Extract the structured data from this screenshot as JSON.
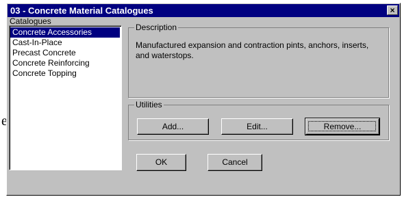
{
  "background": {
    "text_fragment": "e"
  },
  "window": {
    "title": "03 - Concrete Material Catalogues",
    "close_glyph": "×"
  },
  "catalogues": {
    "label": "Catalogues",
    "items": [
      {
        "label": "Concrete Accessories",
        "selected": true
      },
      {
        "label": "Cast-In-Place",
        "selected": false
      },
      {
        "label": "Precast Concrete",
        "selected": false
      },
      {
        "label": "Concrete Reinforcing",
        "selected": false
      },
      {
        "label": "Concrete Topping",
        "selected": false
      }
    ]
  },
  "description": {
    "label": "Description",
    "text": "Manufactured expansion and contraction pints, anchors, inserts, and waterstops."
  },
  "utilities": {
    "label": "Utilities",
    "add_label": "Add...",
    "edit_label": "Edit...",
    "remove_label": "Remove..."
  },
  "dialog": {
    "ok_label": "OK",
    "cancel_label": "Cancel"
  },
  "colors": {
    "titlebar": "#000080",
    "dialog_face": "#c0c0c0",
    "selection": "#000080"
  }
}
